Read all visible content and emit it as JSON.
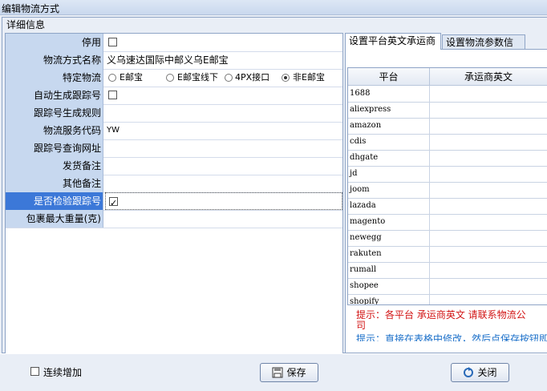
{
  "window": {
    "title": "编辑物流方式"
  },
  "group": {
    "title": "详细信息"
  },
  "properties": [
    {
      "label": "停用",
      "value": ""
    },
    {
      "label": "物流方式名称",
      "value": "义乌速达国际中邮义乌E邮宝"
    },
    {
      "label": "特定物流",
      "value": ""
    },
    {
      "label": "自动生成跟踪号",
      "value": ""
    },
    {
      "label": "跟踪号生成规则",
      "value": ""
    },
    {
      "label": "物流服务代码",
      "value": "YW"
    },
    {
      "label": "跟踪号查询网址",
      "value": ""
    },
    {
      "label": "发货备注",
      "value": ""
    },
    {
      "label": "其他备注",
      "value": ""
    },
    {
      "label": "是否检验跟踪号",
      "value": ""
    },
    {
      "label": "包裹最大重量(克)",
      "value": ""
    }
  ],
  "special_logistics": {
    "options": [
      "E邮宝",
      "E邮宝线下",
      "4PX接口",
      "非E邮宝"
    ],
    "selected": "非E邮宝"
  },
  "checks": {
    "disabled": false,
    "auto_tracking": false,
    "verify_tracking": true
  },
  "tabs": [
    {
      "label": "设置平台英文承运商",
      "active": true
    },
    {
      "label": "设置物流参数信息",
      "active": false
    }
  ],
  "carrier_table": {
    "columns": [
      "平台",
      "承运商英文"
    ],
    "rows": [
      "1688",
      "aliexpress",
      "amazon",
      "cdis",
      "dhgate",
      "jd",
      "joom",
      "lazada",
      "magento",
      "newegg",
      "rakuten",
      "rumall",
      "shopee",
      "shopify"
    ]
  },
  "tips": {
    "tip1": "提示：各平台 承运商英文 请联系物流公司",
    "tip2": "提示：直接在表格中修改，然后点保存按钮即可"
  },
  "footer": {
    "continuous_add_label": "连续增加",
    "continuous_add_checked": false,
    "save_label": "保存",
    "close_label": "关闭"
  }
}
